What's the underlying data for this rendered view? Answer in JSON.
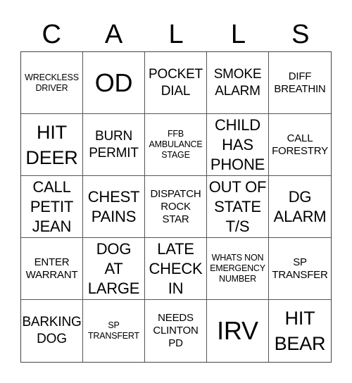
{
  "card": {
    "header_letters": [
      "C",
      "A",
      "L",
      "L",
      "S"
    ],
    "rows": [
      [
        "WRECKLESS\nDRIVER",
        "OD",
        "POCKET\nDIAL",
        "SMOKE\nALARM",
        "DIFF\nBREATHIN"
      ],
      [
        "HIT\nDEER",
        "BURN\nPERMIT",
        "FFB\nAMBULANCE\nSTAGE",
        "CHILD\nHAS\nPHONE",
        "CALL\nFORESTRY"
      ],
      [
        "CALL\nPETIT\nJEAN",
        "CHEST\nPAINS",
        "DISPATCH\nROCK\nSTAR",
        "OUT OF\nSTATE\nT/S",
        "DG\nALARM"
      ],
      [
        "ENTER\nWARRANT",
        "DOG\nAT\nLARGE",
        "LATE\nCHECK\nIN",
        "WHATS NON\nEMERGENCY\nNUMBER",
        "SP\nTRANSFER"
      ],
      [
        "BARKING\nDOG",
        "SP\nTRANSFERT",
        "NEEDS\nCLINTON\nPD",
        "IRV",
        "HIT\nBEAR"
      ]
    ]
  }
}
